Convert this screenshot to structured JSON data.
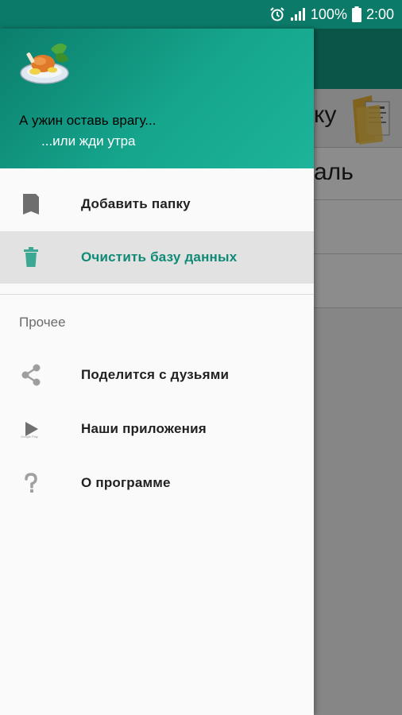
{
  "status_bar": {
    "battery": "100%",
    "time": "2:00",
    "icons": [
      "alarm-icon",
      "signal-icon",
      "battery-icon"
    ]
  },
  "background": {
    "row1_text": "ку",
    "row2_text": "аль"
  },
  "drawer": {
    "header": {
      "line1": "А ужин оставь врагу...",
      "line2": "...или жди утра",
      "logo": "food-plate-logo"
    },
    "items": [
      {
        "label": "Добавить папку",
        "icon": "folder-icon"
      },
      {
        "label": "Очистить базу данных",
        "icon": "trash-icon",
        "active": true
      }
    ],
    "section_title": "Прочее",
    "other_items": [
      {
        "label": "Поделится с дузьями",
        "icon": "share-icon"
      },
      {
        "label": "Наши приложения",
        "icon": "google-play-icon",
        "icon_caption": "Google Play"
      },
      {
        "label": "О программе",
        "icon": "question-icon"
      }
    ]
  },
  "colors": {
    "primary": "#159a84",
    "primary_dark": "#0c7a68",
    "accent_text": "#0f8a76"
  }
}
